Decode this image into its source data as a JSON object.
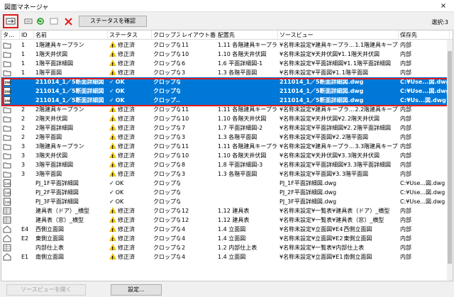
{
  "window": {
    "title": "図面マネージャ",
    "close": "×"
  },
  "toolbar": {
    "check_button": "ステータスを確認",
    "selected": "選択:3"
  },
  "columns": [
    "タ…",
    "ID",
    "名前",
    "ステータス",
    "クロップス…",
    "レイアウト番号",
    "配置先",
    "ソースビュー",
    "保存先"
  ],
  "rows": [
    {
      "icon": "folder",
      "id": "1",
      "name": "1階建具キープラン",
      "status": "修正済",
      "st": "warn",
      "crop": "クロップなし",
      "layout": "11",
      "place": "1.11 各階建具キープラン",
      "source": "¥名称未設定¥建具キープラ...",
      "dest": "1.1階建具キープラン",
      "save": "内部",
      "sel": false
    },
    {
      "icon": "folder",
      "id": "1",
      "name": "1階天井伏図",
      "status": "修正済",
      "st": "warn",
      "crop": "クロップなし",
      "layout": "10",
      "place": "1.10 各階天井伏図",
      "source": "¥名称未設定¥天井伏図¥1.",
      "dest": "1階天井伏図",
      "save": "内部",
      "sel": false
    },
    {
      "icon": "folder",
      "id": "1",
      "name": "1階平面詳細図",
      "status": "修正済",
      "st": "warn",
      "crop": "クロップなし",
      "layout": "6",
      "place": "1.6 平面詳細図-1",
      "source": "¥名称未設定¥平面詳細図¥1.",
      "dest": "1階平面詳細図",
      "save": "内部",
      "sel": false
    },
    {
      "icon": "folder",
      "id": "1",
      "name": "1階平面図",
      "status": "修正済",
      "st": "warn",
      "crop": "クロップなし",
      "layout": "3",
      "place": "1.3 各階平面図",
      "source": "¥名称未設定¥平面図¥1.",
      "dest": "1階平面図",
      "save": "内部",
      "sel": false
    },
    {
      "icon": "dwg",
      "id": "",
      "name": "211014_1／5断面詳細図",
      "status": "OK",
      "st": "ok",
      "crop": "クロップなし",
      "layout": "",
      "place": "",
      "source": "211014_1／5断面詳細図.dwg",
      "dest": "",
      "save": "C:¥Use...図.dwg",
      "sel": true
    },
    {
      "icon": "dwg",
      "id": "",
      "name": "211014_1／5断面詳細図",
      "status": "OK",
      "st": "ok",
      "crop": "クロップなし",
      "layout": "",
      "place": "",
      "source": "211014_1／5断面詳細図.dwg",
      "dest": "",
      "save": "C:¥Use...図.dwg",
      "sel": true
    },
    {
      "icon": "dwg",
      "id": "",
      "name": "211014_1／5断面詳細図",
      "status": "OK",
      "st": "ok",
      "crop": "クロップ...",
      "layout": "",
      "place": "",
      "source": "211014_1／5断面詳細図.dwg",
      "dest": "",
      "save": "C:¥Us...図.dwg",
      "sel": true
    },
    {
      "icon": "folder",
      "id": "2",
      "name": "2階建具キープラン",
      "status": "修正済",
      "st": "warn",
      "crop": "クロップなし",
      "layout": "11",
      "place": "1.11 各階建具キープラン",
      "source": "¥名称未設定¥建具キープラ...",
      "dest": "2.2階建具キープラン",
      "save": "内部",
      "sel": false
    },
    {
      "icon": "folder",
      "id": "2",
      "name": "2階天井伏図",
      "status": "修正済",
      "st": "warn",
      "crop": "クロップなし",
      "layout": "10",
      "place": "1.10 各階天井伏図",
      "source": "¥名称未設定¥天井伏図¥2.",
      "dest": "2階天井伏図",
      "save": "内部",
      "sel": false
    },
    {
      "icon": "folder",
      "id": "2",
      "name": "2階平面詳細図",
      "status": "修正済",
      "st": "warn",
      "crop": "クロップなし",
      "layout": "7",
      "place": "1.7 平面詳細図-2",
      "source": "¥名称未設定¥平面詳細図¥2.",
      "dest": "2階平面詳細図",
      "save": "内部",
      "sel": false
    },
    {
      "icon": "folder",
      "id": "2",
      "name": "2階平面図",
      "status": "修正済",
      "st": "warn",
      "crop": "クロップなし",
      "layout": "3",
      "place": "1.3 各階平面図",
      "source": "¥名称未設定¥平面図¥2.",
      "dest": "2階平面図",
      "save": "内部",
      "sel": false
    },
    {
      "icon": "folder",
      "id": "3",
      "name": "3階建具キープラン",
      "status": "修正済",
      "st": "warn",
      "crop": "クロップなし",
      "layout": "11",
      "place": "1.11 各階建具キープラン",
      "source": "¥名称未設定¥建具キープラ...",
      "dest": "3.3階建具キープラン",
      "save": "内部",
      "sel": false
    },
    {
      "icon": "folder",
      "id": "3",
      "name": "3階天井伏図",
      "status": "修正済",
      "st": "warn",
      "crop": "クロップなし",
      "layout": "10",
      "place": "1.10 各階天井伏図",
      "source": "¥名称未設定¥天井伏図¥3.",
      "dest": "3階天井伏図",
      "save": "内部",
      "sel": false
    },
    {
      "icon": "folder",
      "id": "3",
      "name": "3階平面詳細図",
      "status": "修正済",
      "st": "warn",
      "crop": "クロップなし",
      "layout": "8",
      "place": "1.8 平面詳細図-3",
      "source": "¥名称未設定¥平面詳細図¥3.",
      "dest": "3階平面詳細図",
      "save": "内部",
      "sel": false
    },
    {
      "icon": "folder",
      "id": "3",
      "name": "3階平面図",
      "status": "修正済",
      "st": "warn",
      "crop": "クロップなし",
      "layout": "3",
      "place": "1.3 各階平面図",
      "source": "¥名称未設定¥平面図¥3.",
      "dest": "3階平面図",
      "save": "内部",
      "sel": false
    },
    {
      "icon": "dwg",
      "id": "",
      "name": "PJ_1F平面詳細図",
      "status": "OK",
      "st": "ok",
      "crop": "クロップなし",
      "layout": "",
      "place": "",
      "source": "PJ_1F平面詳細図.dwg",
      "dest": "",
      "save": "C:¥Use...図.dwg",
      "sel": false
    },
    {
      "icon": "dwg",
      "id": "",
      "name": "PJ_2F平面詳細図",
      "status": "OK",
      "st": "ok",
      "crop": "クロップなし",
      "layout": "",
      "place": "",
      "source": "PJ_2F平面詳細図.dwg",
      "dest": "",
      "save": "C:¥Use...図.dwg",
      "sel": false
    },
    {
      "icon": "dwg",
      "id": "",
      "name": "PJ_3F平面詳細図",
      "status": "OK",
      "st": "ok",
      "crop": "クロップなし",
      "layout": "",
      "place": "",
      "source": "PJ_3F平面詳細図.dwg",
      "dest": "",
      "save": "C:¥Use...図.dwg",
      "sel": false
    },
    {
      "icon": "grid",
      "id": "",
      "name": "建具表（ドア）_横型",
      "status": "修正済",
      "st": "warn",
      "crop": "クロップなし",
      "layout": "12",
      "place": "1.12 建具表",
      "source": "¥名称未設定¥一覧表¥建具表（ドア）_横型",
      "dest": "",
      "save": "内部",
      "sel": false
    },
    {
      "icon": "grid",
      "id": "",
      "name": "建具表（窓）_横型",
      "status": "修正済",
      "st": "warn",
      "crop": "クロップなし",
      "layout": "12",
      "place": "1.12 建具表",
      "source": "¥名称未設定¥一覧表¥建具表（窓）_横型",
      "dest": "",
      "save": "内部",
      "sel": false
    },
    {
      "icon": "elev",
      "id": "E4",
      "name": "西側立面図",
      "status": "修正済",
      "st": "warn",
      "crop": "クロップなし",
      "layout": "4",
      "place": "1.4 立面図",
      "source": "¥名称未設定¥立面図¥E4",
      "dest": "西側立面図",
      "save": "内部",
      "sel": false
    },
    {
      "icon": "elev",
      "id": "E2",
      "name": "東側立面図",
      "status": "修正済",
      "st": "warn",
      "crop": "クロップなし",
      "layout": "4",
      "place": "1.4 立面図",
      "source": "¥名称未設定¥立面図¥E2",
      "dest": "東側立面図",
      "save": "内部",
      "sel": false
    },
    {
      "icon": "grid",
      "id": "",
      "name": "内部仕上表",
      "status": "修正済",
      "st": "warn",
      "crop": "クロップなし",
      "layout": "2",
      "place": "1.2 内部仕上表",
      "source": "¥名称未設定¥一覧表¥内部仕上表",
      "dest": "",
      "save": "内部",
      "sel": false
    },
    {
      "icon": "elev",
      "id": "E1",
      "name": "南側立面図",
      "status": "修正済",
      "st": "warn",
      "crop": "クロップなし",
      "layout": "4",
      "place": "1.4 立面図",
      "source": "¥名称未設定¥立面図¥E1",
      "dest": "南側立面図",
      "save": "内部",
      "sel": false
    }
  ],
  "bottom": {
    "open_source": "ソースビューを開く",
    "settings": "設定..."
  },
  "colors": {
    "selection": "#0078d7",
    "highlight": "#e21b1b",
    "warning": "#f2c200"
  }
}
